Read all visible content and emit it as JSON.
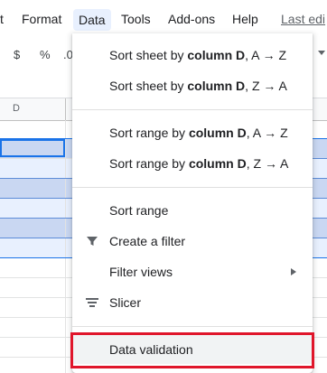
{
  "menubar": {
    "items": [
      "t",
      "Format",
      "Data",
      "Tools",
      "Add-ons",
      "Help"
    ],
    "last_edit": "Last edi"
  },
  "toolbar": {
    "currency": "$",
    "percent": "%",
    "decimal": ".0"
  },
  "sheet": {
    "column_label": "D"
  },
  "data_menu": {
    "sort_sheet_az": {
      "prefix": "Sort sheet by ",
      "bold": "column D",
      "suffix": ", A → Z"
    },
    "sort_sheet_za": {
      "prefix": "Sort sheet by ",
      "bold": "column D",
      "suffix": ", Z → A"
    },
    "sort_range_az": {
      "prefix": "Sort range by ",
      "bold": "column D",
      "suffix": ", A → Z"
    },
    "sort_range_za": {
      "prefix": "Sort range by ",
      "bold": "column D",
      "suffix": ", Z → A"
    },
    "sort_range": "Sort range",
    "create_filter": "Create a filter",
    "filter_views": "Filter views",
    "slicer": "Slicer",
    "data_validation": "Data validation"
  },
  "colors": {
    "selection_fill": "#c9d7f2",
    "selection_light": "#e8f0fe",
    "selection_border": "#1a73e8",
    "highlight_box": "#e0162b"
  },
  "icons": {
    "filter": "funnel-icon",
    "slicer": "slicer-icon",
    "submenu": "triangle-right-icon"
  }
}
